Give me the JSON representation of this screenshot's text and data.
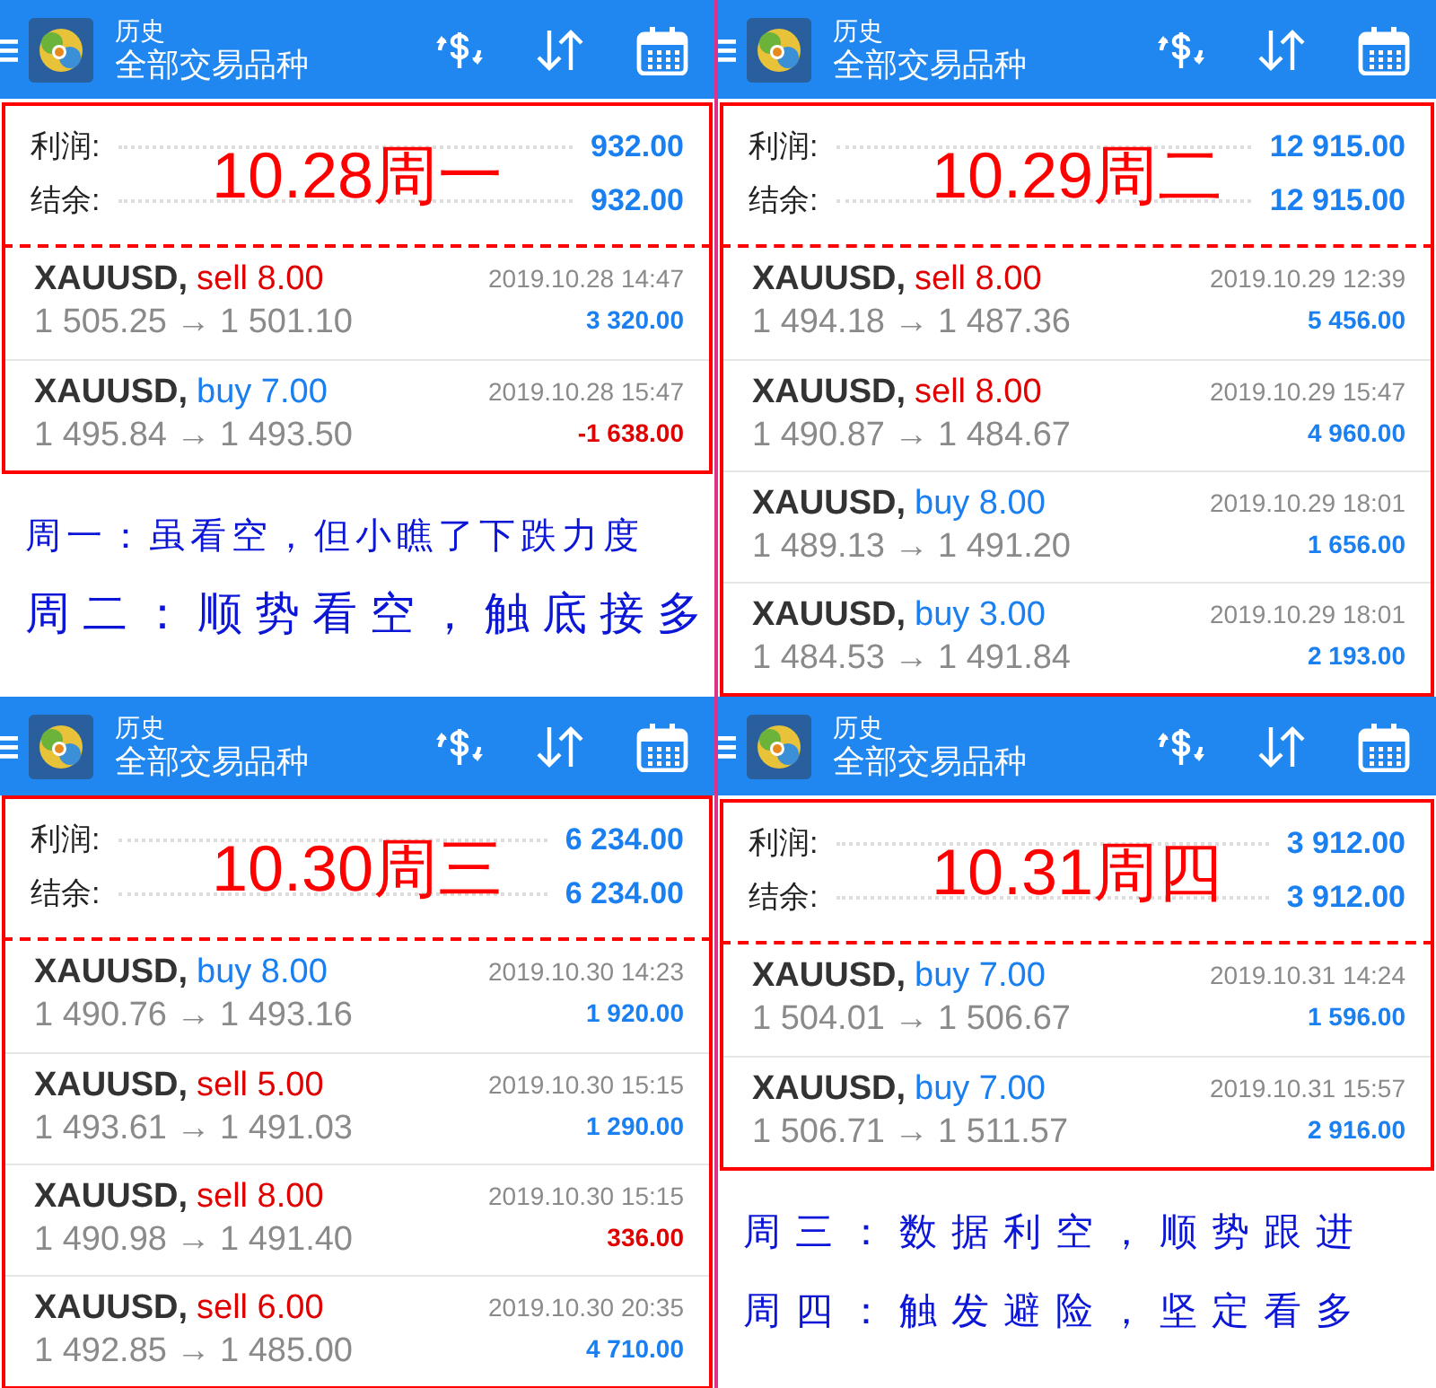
{
  "panels": [
    {
      "header": {
        "title": "历史",
        "subtitle": "全部交易品种"
      },
      "summary": [
        {
          "label": "利润:",
          "value": "932.00"
        },
        {
          "label": "结余:",
          "value": "932.00"
        }
      ],
      "date_label": "10.28周一",
      "trades": [
        {
          "symbol": "XAUUSD,",
          "kind": "sell",
          "side": "sell 8.00",
          "time": "2019.10.28 14:47",
          "prices": "1 505.25 → 1 501.10",
          "profit": "3 320.00",
          "loss": false
        },
        {
          "symbol": "XAUUSD,",
          "kind": "buy",
          "side": "buy 7.00",
          "time": "2019.10.28 15:47",
          "prices": "1 495.84 → 1 493.50",
          "profit": "-1 638.00",
          "loss": true
        }
      ],
      "notes": [
        "周一：虽看空，但小瞧了下跌力度",
        "周二：顺势看空，触底接多"
      ]
    },
    {
      "header": {
        "title": "历史",
        "subtitle": "全部交易品种"
      },
      "summary": [
        {
          "label": "利润:",
          "value": "12 915.00"
        },
        {
          "label": "结余:",
          "value": "12 915.00"
        }
      ],
      "date_label": "10.29周二",
      "trades": [
        {
          "symbol": "XAUUSD,",
          "kind": "sell",
          "side": "sell 8.00",
          "time": "2019.10.29 12:39",
          "prices": "1 494.18 → 1 487.36",
          "profit": "5 456.00",
          "loss": false
        },
        {
          "symbol": "XAUUSD,",
          "kind": "sell",
          "side": "sell 8.00",
          "time": "2019.10.29 15:47",
          "prices": "1 490.87 → 1 484.67",
          "profit": "4 960.00",
          "loss": false
        },
        {
          "symbol": "XAUUSD,",
          "kind": "buy",
          "side": "buy 8.00",
          "time": "2019.10.29 18:01",
          "prices": "1 489.13 → 1 491.20",
          "profit": "1 656.00",
          "loss": false
        },
        {
          "symbol": "XAUUSD,",
          "kind": "buy",
          "side": "buy 3.00",
          "time": "2019.10.29 18:01",
          "prices": "1 484.53 → 1 491.84",
          "profit": "2 193.00",
          "loss": false
        }
      ]
    },
    {
      "header": {
        "title": "历史",
        "subtitle": "全部交易品种"
      },
      "summary": [
        {
          "label": "利润:",
          "value": "6 234.00"
        },
        {
          "label": "结余:",
          "value": "6 234.00"
        }
      ],
      "date_label": "10.30周三",
      "trades": [
        {
          "symbol": "XAUUSD,",
          "kind": "buy",
          "side": "buy 8.00",
          "time": "2019.10.30 14:23",
          "prices": "1 490.76 → 1 493.16",
          "profit": "1 920.00",
          "loss": false
        },
        {
          "symbol": "XAUUSD,",
          "kind": "sell",
          "side": "sell 5.00",
          "time": "2019.10.30 15:15",
          "prices": "1 493.61 → 1 491.03",
          "profit": "1 290.00",
          "loss": false
        },
        {
          "symbol": "XAUUSD,",
          "kind": "sell",
          "side": "sell 8.00",
          "time": "2019.10.30 15:15",
          "prices": "1 490.98 → 1 491.40",
          "profit": "336.00",
          "loss": true
        },
        {
          "symbol": "XAUUSD,",
          "kind": "sell",
          "side": "sell 6.00",
          "time": "2019.10.30 20:35",
          "prices": "1 492.85 → 1 485.00",
          "profit": "4 710.00",
          "loss": false
        }
      ]
    },
    {
      "header": {
        "title": "历史",
        "subtitle": "全部交易品种"
      },
      "summary": [
        {
          "label": "利润:",
          "value": "3 912.00"
        },
        {
          "label": "结余:",
          "value": "3 912.00"
        }
      ],
      "date_label": "10.31周四",
      "trades": [
        {
          "symbol": "XAUUSD,",
          "kind": "buy",
          "side": "buy 7.00",
          "time": "2019.10.31 14:24",
          "prices": "1 504.01 → 1 506.67",
          "profit": "1 596.00",
          "loss": false
        },
        {
          "symbol": "XAUUSD,",
          "kind": "buy",
          "side": "buy 7.00",
          "time": "2019.10.31 15:57",
          "prices": "1 506.71 → 1 511.57",
          "profit": "2 916.00",
          "loss": false
        }
      ],
      "notes": [
        "周三：数据利空，顺势跟进",
        "周四：触发避险，坚定看多"
      ]
    }
  ]
}
